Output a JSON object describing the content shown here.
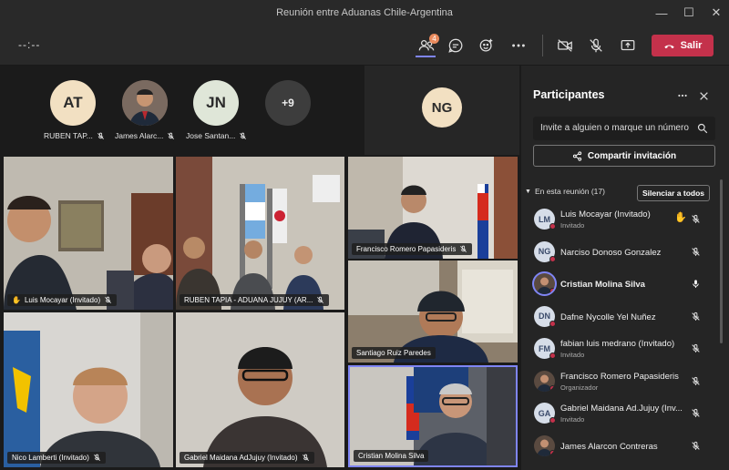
{
  "window": {
    "title": "Reunión entre Aduanas Chile-Argentina",
    "minimize": "—",
    "maximize": "☐",
    "close": "✕"
  },
  "toolbar": {
    "timer": "--:--",
    "participants_badge": "4",
    "leave_label": "Salir"
  },
  "strip": [
    {
      "initials": "AT",
      "name": "RUBEN TAP...",
      "color": "#f2e0c2"
    },
    {
      "initials": "",
      "name": "James Alarc...",
      "color": "#6a5a50"
    },
    {
      "initials": "JN",
      "name": "Jose Santan...",
      "color": "#dfe6d8"
    },
    {
      "initials": "+9",
      "name": "",
      "color": "#3d3d3d"
    }
  ],
  "spotlight_avatar": {
    "initials": "NG",
    "color": "#f2e0c2"
  },
  "tiles": [
    {
      "name": "Luis Mocayar (Invitado)",
      "hand": "✋"
    },
    {
      "name": "RUBEN TAPIA - ADUANA JUJUY (AR..."
    },
    {
      "name": "Francisco Romero Papasideris"
    },
    {
      "name": "Santiago Ruiz Paredes"
    },
    {
      "name": "Nico Lamberti (Invitado)"
    },
    {
      "name": "Gabriel Maidana AdJujuy (Invitado)"
    },
    {
      "name": "Cristian Molina Silva"
    }
  ],
  "panel": {
    "title": "Participantes",
    "search_placeholder": "Invite a alguien o marque un número",
    "share_label": "Compartir invitación",
    "section_label": "En esta reunión (17)",
    "silence_label": "Silenciar a todos",
    "participants": [
      {
        "initials": "LM",
        "name": "Luis Mocayar (Invitado)",
        "role": "Invitado",
        "hand": "✋",
        "muted": true
      },
      {
        "initials": "NG",
        "name": "Narciso Donoso Gonzalez",
        "role": "",
        "muted": true
      },
      {
        "initials": "",
        "name": "Cristian Molina Silva",
        "role": "",
        "muted": false,
        "bold": true
      },
      {
        "initials": "DN",
        "name": "Dafne Nycolle Yel Nuñez",
        "role": "",
        "muted": true
      },
      {
        "initials": "FM",
        "name": "fabian luis medrano (Invitado)",
        "role": "Invitado",
        "muted": true
      },
      {
        "initials": "",
        "name": "Francisco Romero Papasideris",
        "role": "Organizador",
        "muted": true
      },
      {
        "initials": "GA",
        "name": "Gabriel Maidana Ad.Jujuy (Inv...",
        "role": "Invitado",
        "muted": true
      },
      {
        "initials": "",
        "name": "James Alarcon Contreras",
        "role": "",
        "muted": true
      }
    ]
  },
  "colors": {
    "accent": "#7f85f5",
    "leave": "#c4314b",
    "panel_bg": "#252525"
  }
}
